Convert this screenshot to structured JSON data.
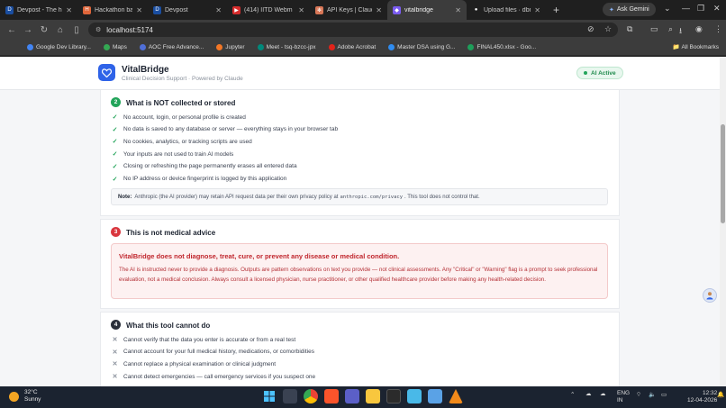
{
  "browser": {
    "tabs": [
      {
        "title": "Devpost - The ho",
        "favicon": "D",
        "color": "#1a4ea1",
        "active": false
      },
      {
        "title": "Hackathon bat ch",
        "favicon": "H",
        "color": "#e0663a",
        "active": false
      },
      {
        "title": "Devpost",
        "favicon": "D",
        "color": "#1a4ea1",
        "active": false
      },
      {
        "title": "(414) IITD Webm",
        "favicon": "▶",
        "color": "#d62d2d",
        "active": false
      },
      {
        "title": "API Keys | Claude",
        "favicon": "✻",
        "color": "#d97757",
        "active": false
      },
      {
        "title": "vitalbridge",
        "favicon": "◆",
        "color": "#7b5cf0",
        "active": true
      },
      {
        "title": "Upload files · dbm",
        "favicon": "●",
        "color": "#ffffff",
        "active": false
      }
    ],
    "gemini_label": "Ask Gemini",
    "url": "localhost:5174",
    "bookmarks": [
      {
        "label": "Google Dev Library...",
        "color": "#4285f4"
      },
      {
        "label": "Maps",
        "color": "#34a853"
      },
      {
        "label": "AOC Free Advance...",
        "color": "#4f6fd8"
      },
      {
        "label": "Jupyter",
        "color": "#f37726"
      },
      {
        "label": "Meet - tsq-bzcc-jpx",
        "color": "#00897b"
      },
      {
        "label": "Adobe Acrobat",
        "color": "#e2231a"
      },
      {
        "label": "Master DSA using G...",
        "color": "#2f8cf0"
      },
      {
        "label": "FINAL450.xlsx - Goo...",
        "color": "#1e9e5a"
      }
    ],
    "all_bookmarks": "All Bookmarks"
  },
  "app": {
    "name": "VitalBridge",
    "tagline": "Clinical Decision Support · Powered by Claude",
    "status": "AI Active",
    "status_color": "#22a45a"
  },
  "sections": {
    "not_collected": {
      "number": "2",
      "title": "What is NOT collected or stored",
      "color": "#22a45a",
      "items": [
        "No account, login, or personal profile is created",
        "No data is saved to any database or server — everything stays in your browser tab",
        "No cookies, analytics, or tracking scripts are used",
        "Your inputs are not used to train AI models",
        "Closing or refreshing the page permanently erases all entered data",
        "No IP address or device fingerprint is logged by this application"
      ],
      "note_label": "Note:",
      "note_pre": "Anthropic (the AI provider) may retain API request data per their own privacy policy at",
      "note_code": "anthropic.com/privacy",
      "note_post": ". This tool does not control that."
    },
    "not_advice": {
      "number": "3",
      "title": "This is not medical advice",
      "color": "#d9363e",
      "alert_title": "VitalBridge does not diagnose, treat, cure, or prevent any disease or medical condition.",
      "alert_body": "The AI is instructed never to provide a diagnosis. Outputs are pattern observations on text you provide — not clinical assessments. Any \"Critical\" or \"Warning\" flag is a prompt to seek professional evaluation, not a medical conclusion. Always consult a licensed physician, nurse practitioner, or other qualified healthcare provider before making any health-related decision."
    },
    "cannot_do": {
      "number": "4",
      "title": "What this tool cannot do",
      "color": "#2a2f3a",
      "items": [
        "Cannot verify that the data you enter is accurate or from a real test",
        "Cannot account for your full medical history, medications, or comorbidities",
        "Cannot replace a physical examination or clinical judgment",
        "Cannot detect emergencies — call emergency services if you suspect one"
      ]
    }
  },
  "taskbar": {
    "temp": "32°C",
    "weather": "Sunny",
    "lang": "ENG",
    "region": "IN",
    "time": "12:32",
    "date": "12-04-2026"
  }
}
